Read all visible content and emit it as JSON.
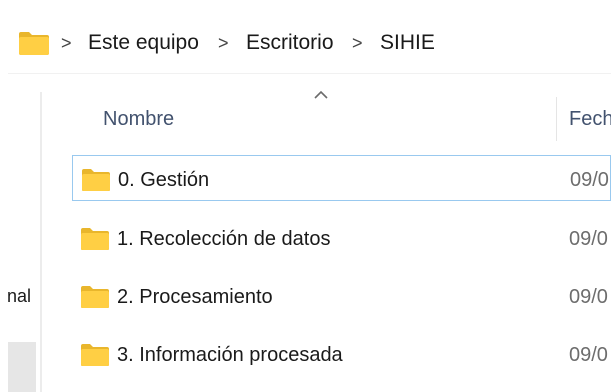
{
  "breadcrumb": {
    "items": [
      "Este equipo",
      "Escritorio",
      "SIHIE"
    ],
    "separator": ">"
  },
  "navigation": {
    "partial_label": "nal"
  },
  "columns": {
    "name": "Nombre",
    "date": "Fech",
    "sort_indicator": "^"
  },
  "files": [
    {
      "name": "0. Gestión",
      "date": "09/0",
      "type": "folder",
      "selected": true
    },
    {
      "name": "1. Recolección de datos",
      "date": "09/0",
      "type": "folder",
      "selected": false
    },
    {
      "name": "2. Procesamiento",
      "date": "09/0",
      "type": "folder",
      "selected": false
    },
    {
      "name": "3. Información procesada",
      "date": "09/0",
      "type": "folder",
      "selected": false
    }
  ],
  "colors": {
    "folder": "#ffcf44",
    "folder_shade": "#e9b62c",
    "selection_border": "#99c9ef",
    "header_text": "#42526e"
  },
  "icons": {
    "breadcrumb_root": "folder-icon",
    "row": "folder-icon"
  }
}
